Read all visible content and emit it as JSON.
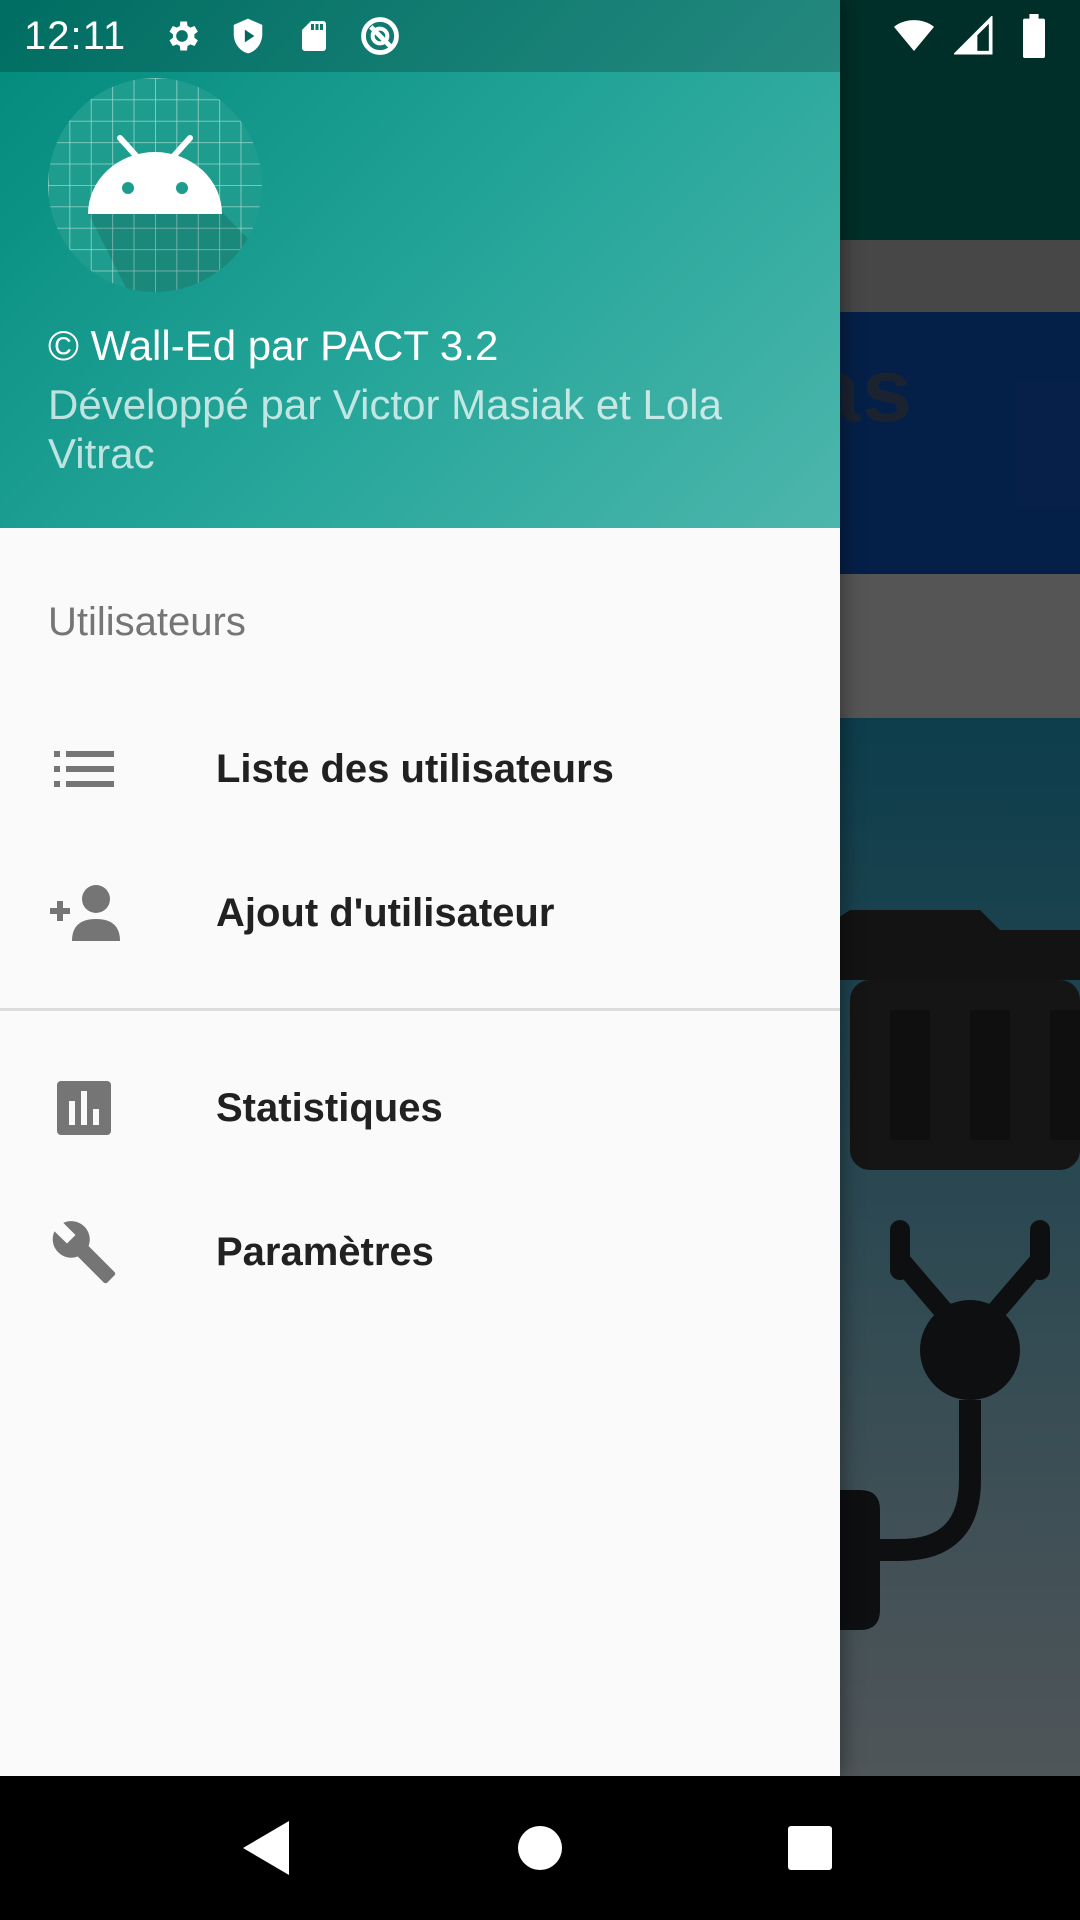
{
  "status_bar": {
    "time": "12:11",
    "left_icons": [
      "gear-icon",
      "shield-icon",
      "sd-card-icon",
      "do-not-disturb-icon"
    ],
    "right_icons": [
      "wifi-icon",
      "cell-signal-icon",
      "battery-icon"
    ]
  },
  "drawer": {
    "header": {
      "title": "© Wall-Ed par PACT 3.2",
      "subtitle": "Développé par Victor Masiak et Lola Vitrac",
      "avatar_icon": "android-icon"
    },
    "section_label": "Utilisateurs",
    "items": [
      {
        "label": "Liste des utilisateurs",
        "icon": "list-icon"
      },
      {
        "label": "Ajout d'utilisateur",
        "icon": "person-add-icon"
      },
      {
        "label": "Statistiques",
        "icon": "bar-chart-icon"
      },
      {
        "label": "Paramètres",
        "icon": "wrench-icon"
      }
    ]
  },
  "background": {
    "card_text_fragment": "as"
  },
  "nav_bar": {
    "buttons": [
      "back-icon",
      "home-icon",
      "recents-icon"
    ]
  },
  "colors": {
    "header_start": "#00897b",
    "header_end": "#4db6ac",
    "drawer_bg": "#fafafa",
    "icon_gray": "#757575",
    "text_primary": "#212121"
  }
}
